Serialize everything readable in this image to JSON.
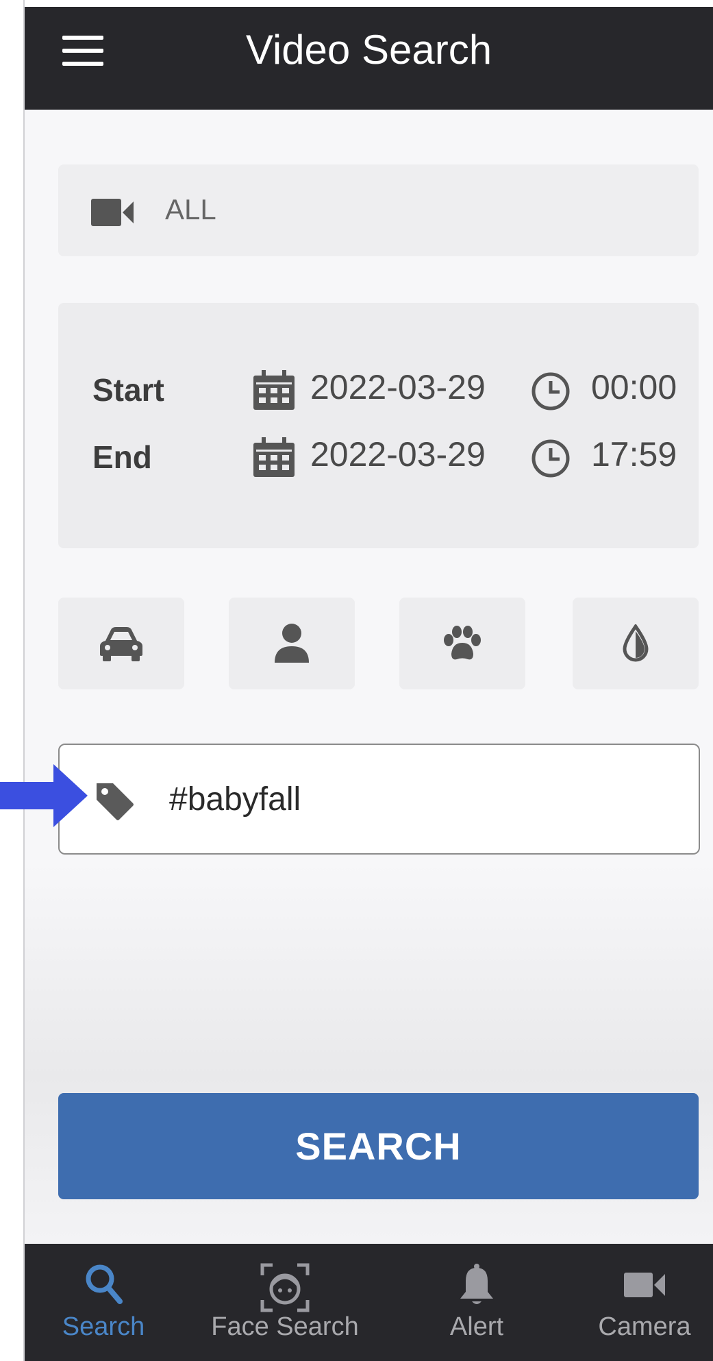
{
  "header": {
    "title": "Video Search"
  },
  "camera": {
    "value": "ALL"
  },
  "time_range": {
    "start": {
      "label": "Start",
      "date": "2022-03-29",
      "time": "00:00"
    },
    "end": {
      "label": "End",
      "date": "2022-03-29",
      "time": "17:59"
    }
  },
  "categories": [
    "car-icon",
    "person-icon",
    "paw-icon",
    "droplet-icon"
  ],
  "tag_search": {
    "value": "#babyfall"
  },
  "search_button": {
    "label": "SEARCH"
  },
  "bottom_nav": {
    "items": [
      {
        "label": "Search",
        "icon": "search-icon",
        "active": true
      },
      {
        "label": "Face Search",
        "icon": "face-scan-icon",
        "active": false
      },
      {
        "label": "Alert",
        "icon": "bell-icon",
        "active": false
      },
      {
        "label": "Camera",
        "icon": "video-camera-icon",
        "active": false
      }
    ]
  },
  "colors": {
    "header_bg": "#27272b",
    "primary": "#3e6daf",
    "active_nav": "#4a86c8",
    "annotation_arrow": "#3b4fe0"
  }
}
